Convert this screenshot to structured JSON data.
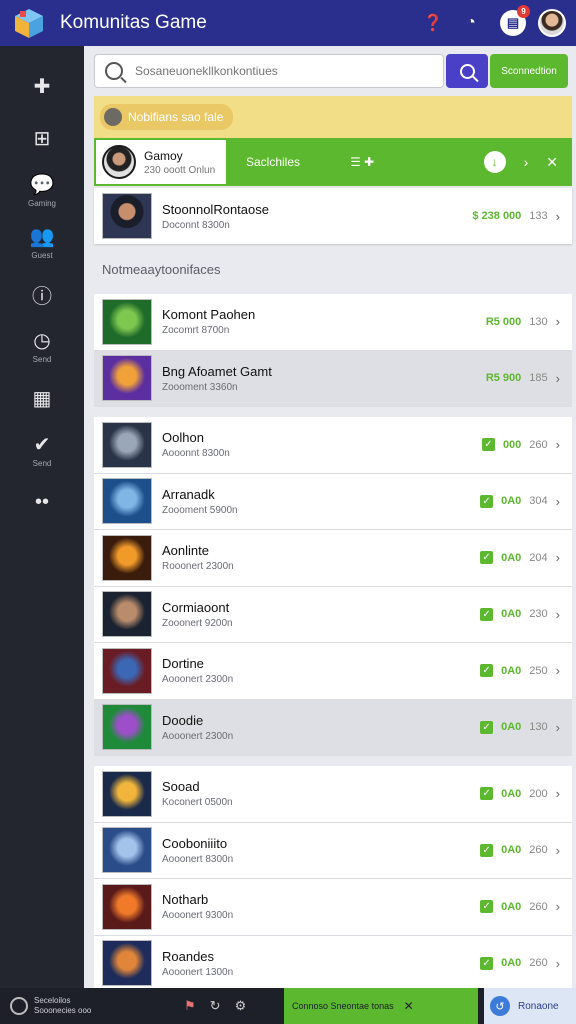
{
  "app": {
    "title": "Komunitas Game",
    "notification_count": "9"
  },
  "sidebar": {
    "items": [
      {
        "icon": "puzzle-icon",
        "glyph": "✚",
        "label": ""
      },
      {
        "icon": "grid-icon",
        "glyph": "⊞",
        "label": ""
      },
      {
        "icon": "chat-icon",
        "glyph": "💬",
        "label": "Gaming"
      },
      {
        "icon": "users-icon",
        "glyph": "👥",
        "label": "Guest"
      },
      {
        "icon": "info-icon",
        "glyph": "ⓘ",
        "label": ""
      },
      {
        "icon": "clock-icon",
        "glyph": "◷",
        "label": "Send"
      },
      {
        "icon": "table-icon",
        "glyph": "▦",
        "label": ""
      },
      {
        "icon": "check-icon",
        "glyph": "✔",
        "label": "Send"
      },
      {
        "icon": "more-icon",
        "glyph": "••",
        "label": ""
      }
    ]
  },
  "search": {
    "placeholder": "Sosaneuonekllkonkontiues",
    "go_label": "Sconnedtion"
  },
  "banner": {
    "label": "Nobifians sao fale"
  },
  "feature": {
    "title": "Gamoy",
    "subtitle": "230 ooott Onlun",
    "mid_label": "Saclchiles",
    "mid_label2": "☰ ✚"
  },
  "top_item": {
    "title": "StoonnolRontaose",
    "subtitle": "Doconnt 8300n",
    "value": "$ 238 000",
    "count": "133"
  },
  "section_label": "Notmeaaytoonifaces",
  "rows": [
    {
      "title": "Komont Paohen",
      "subtitle": "Zocomrt 8700n",
      "value": "R5 000",
      "count": "130",
      "check": false
    },
    {
      "title": "Bng Afoamet Gamt",
      "subtitle": "Zoooment 3360n",
      "value": "R5 900",
      "count": "185",
      "check": false
    },
    {
      "title": "Oolhon",
      "subtitle": "Aooonnt 8300n",
      "value": "000",
      "count": "260",
      "check": true
    },
    {
      "title": "Arranadk",
      "subtitle": "Zoooment 5900n",
      "value": "0A0",
      "count": "304",
      "check": true
    },
    {
      "title": "Aonlinte",
      "subtitle": "Rooonert 2300n",
      "value": "0A0",
      "count": "204",
      "check": true
    },
    {
      "title": "Cormiaoont",
      "subtitle": "Zooonert 9200n",
      "value": "0A0",
      "count": "230",
      "check": true
    },
    {
      "title": "Dortine",
      "subtitle": "Aooonert 2300n",
      "value": "0A0",
      "count": "250",
      "check": true
    },
    {
      "title": "Doodie",
      "subtitle": "Aooonert 2300n",
      "value": "0A0",
      "count": "130",
      "check": true
    },
    {
      "title": "Sooad",
      "subtitle": "Koconert 0500n",
      "value": "0A0",
      "count": "200",
      "check": true
    },
    {
      "title": "Cooboniiito",
      "subtitle": "Aooonert 8300n",
      "value": "0A0",
      "count": "260",
      "check": true
    },
    {
      "title": "Notharb",
      "subtitle": "Aooonert 9300n",
      "value": "0A0",
      "count": "260",
      "check": true
    },
    {
      "title": "Roandes",
      "subtitle": "Aooonert 1300n",
      "value": "0A0",
      "count": "260",
      "check": true
    }
  ],
  "bottom": {
    "status_line1": "Seceloilos",
    "status_line2": "Sooonecies ooo",
    "green_label": "Connoso Sneontae tonas",
    "blue_label": "Ronaone"
  },
  "colors": {
    "brand": "#2a2e8c",
    "accent_green": "#5cb82e",
    "accent_purple": "#4a40c8",
    "banner_yellow": "#f2de86",
    "sidebar": "#23262f"
  }
}
